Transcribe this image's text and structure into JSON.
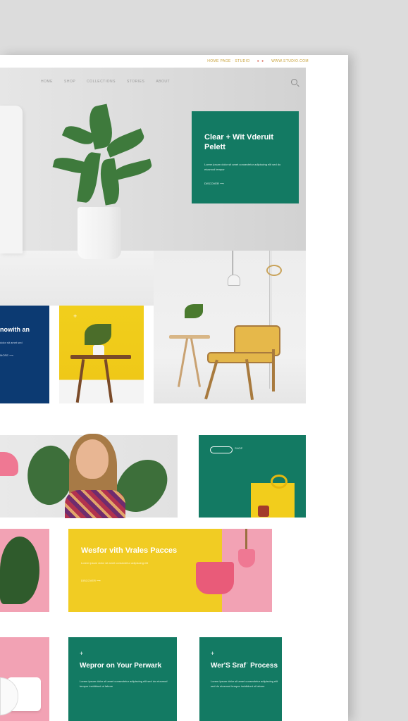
{
  "topbar": {
    "left_text": "HOME PAGE · STUDIO",
    "right_text": "WWW.STUDIO.COM",
    "dots": "● ●"
  },
  "nav": {
    "items": [
      "HOME",
      "SHOP",
      "COLLECTIONS",
      "STORIES",
      "ABOUT"
    ]
  },
  "hero": {
    "title": "Clear + Wit Vderuit Pelett",
    "copy": "Lorem ipsum dolor sit amet consectetur adipiscing elit sed do eiusmod tempor",
    "link": "DISCOVER ⟶"
  },
  "navy_card": {
    "title": "nowith an",
    "subtitle": "dolor sit amet sed",
    "link": "MORE ⟶"
  },
  "yellow_card": {
    "plus": "+"
  },
  "green_card_2": {
    "label": "SHOP"
  },
  "feature": {
    "title": "Wesfor vith Vrales Pacces",
    "subtitle": "Lorem ipsum dolor sit amet consectetur adipiscing elit",
    "link": "DISCOVER ⟶"
  },
  "card_a": {
    "plus": "+",
    "title": "Wepror on Your Perwark",
    "copy": "Lorem ipsum dolor sit amet consectetur adipiscing elit sed do eiusmod tempor incididunt ut labore"
  },
  "card_b": {
    "plus": "+",
    "title": "Wer'S Srafˈ Process",
    "copy": "Lorem ipsum dolor sit amet consectetur adipiscing elit sed do eiusmod tempor incididunt ut labore"
  },
  "colors": {
    "green": "#137a63",
    "navy": "#0c3a72",
    "yellow": "#f1cc23",
    "pink": "#f2a2b4"
  }
}
